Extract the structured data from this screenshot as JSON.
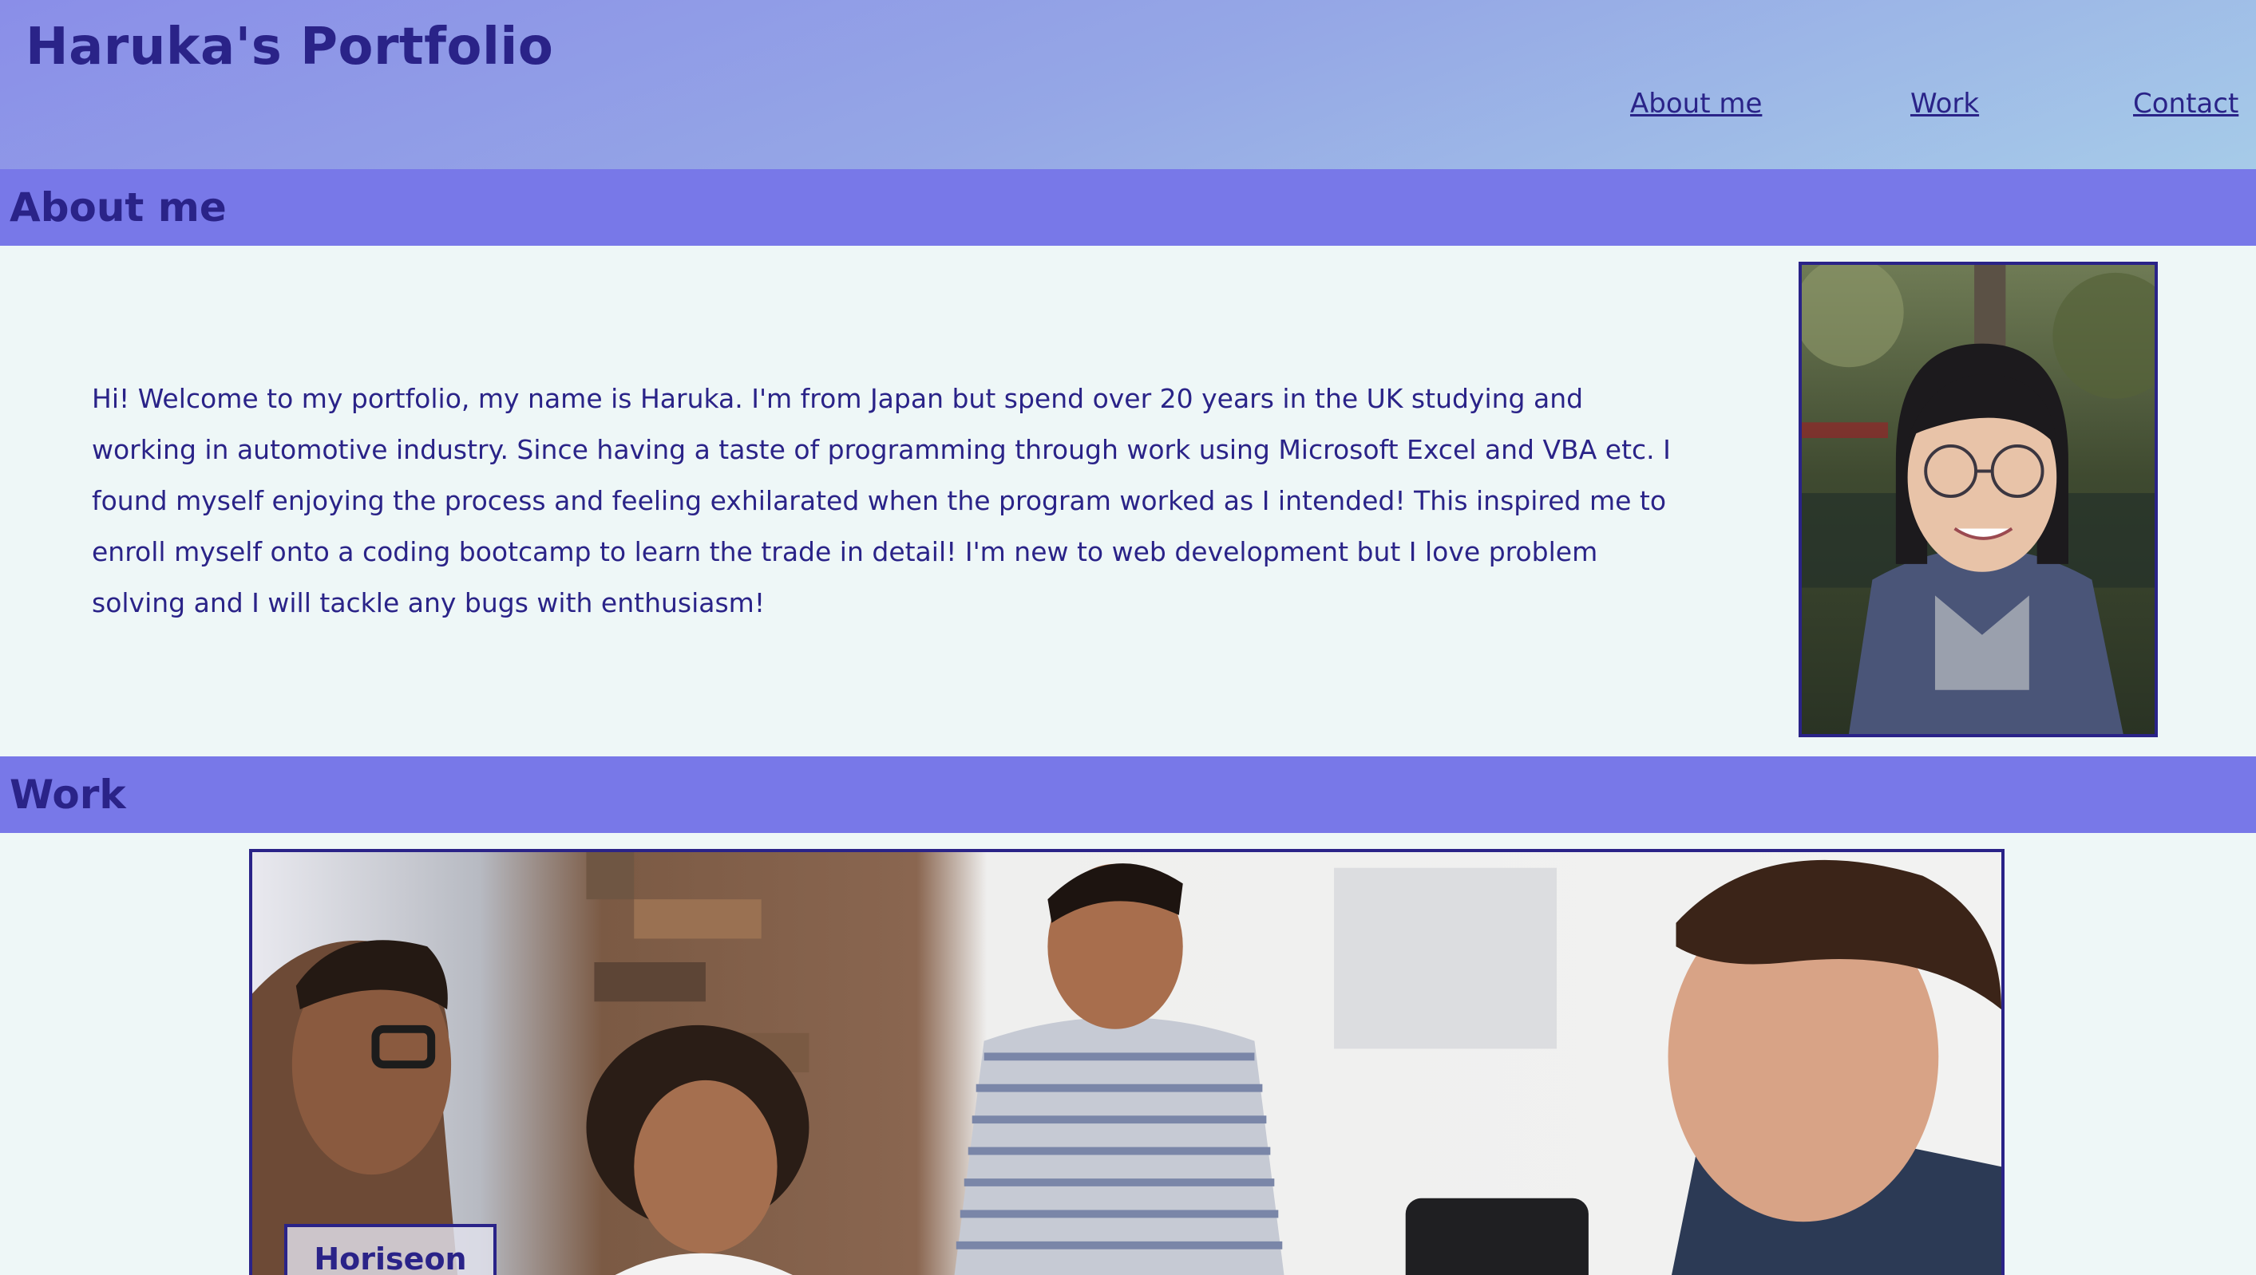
{
  "header": {
    "title": "Haruka's Portfolio",
    "nav": [
      "About me",
      "Work",
      "Contact"
    ]
  },
  "about": {
    "heading": "About me",
    "text": "Hi! Welcome to my portfolio, my name is Haruka. I'm from Japan but spend over 20 years in the UK studying and working in automotive industry. Since having a taste of programming through work using Microsoft Excel and VBA etc. I found myself enjoying the process and feeling exhilarated when the program worked as I intended! This inspired me to enroll myself onto a coding bootcamp to learn the trade in detail! I'm new to web development but I love problem solving and I will tackle any bugs with enthusiasm!"
  },
  "work": {
    "heading": "Work",
    "project_label": "Horiseon"
  },
  "colors": {
    "primary_text": "#2a2388",
    "section_bar": "#7878e8",
    "page_background": "#eef7f7",
    "header_gradient_start": "#8a8ee8",
    "header_gradient_end": "#a6cbe8"
  }
}
